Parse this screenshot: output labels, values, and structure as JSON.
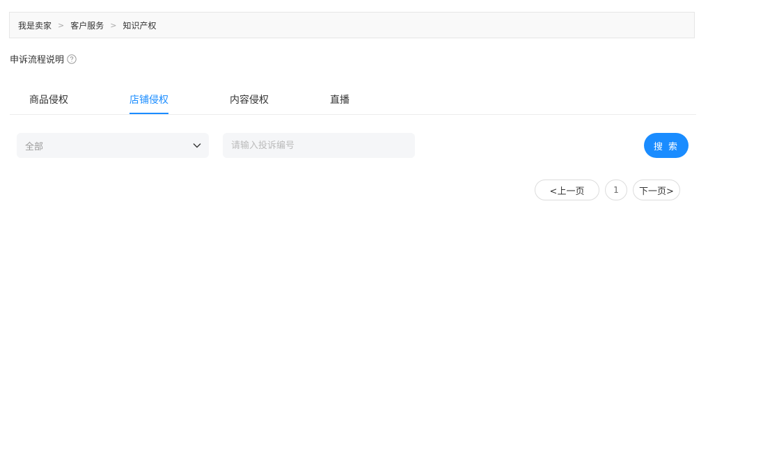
{
  "breadcrumb": {
    "items": [
      "我是卖家",
      "客户服务",
      "知识产权"
    ],
    "separator": ">"
  },
  "help": {
    "label": "申诉流程说明",
    "icon": "question-circle-icon"
  },
  "tabs": [
    {
      "label": "商品侵权",
      "active": false
    },
    {
      "label": "店铺侵权",
      "active": true
    },
    {
      "label": "内容侵权",
      "active": false
    },
    {
      "label": "直播",
      "active": false
    }
  ],
  "filter": {
    "select_value": "全部",
    "search_placeholder": "请输入投诉编号",
    "search_value": "",
    "search_button": "搜 索"
  },
  "pagination": {
    "prev_label": "<上一页",
    "current_page": "1",
    "next_label": "下一页>"
  },
  "colors": {
    "accent": "#1a8cff",
    "input_bg": "#f5f6f8",
    "breadcrumb_bg": "#f9f9f9"
  }
}
